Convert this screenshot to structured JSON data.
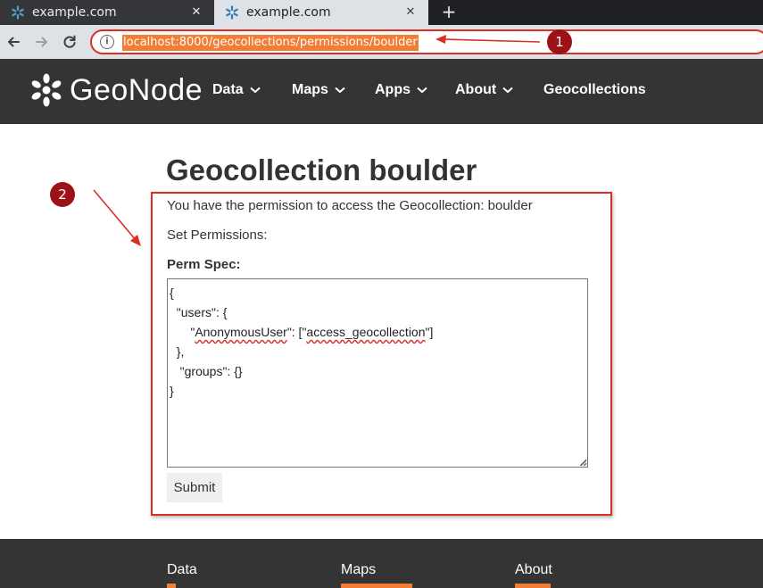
{
  "browser": {
    "tabs": [
      {
        "title": "example.com",
        "active": false
      },
      {
        "title": "example.com",
        "active": true
      }
    ],
    "new_tab_label": "+",
    "close_glyph": "✕",
    "url": "localhost:8000/geocollections/permissions/boulder",
    "nav_icons": [
      "arrow-back-icon",
      "arrow-forward-icon",
      "reload-icon"
    ]
  },
  "annotations": {
    "badge_1": "1",
    "badge_2": "2",
    "color": "#9c1216"
  },
  "header": {
    "logo_text": "GeoNode",
    "nav": [
      {
        "label": "Data",
        "has_dropdown": true
      },
      {
        "label": "Maps",
        "has_dropdown": true
      },
      {
        "label": "Apps",
        "has_dropdown": true
      },
      {
        "label": "About",
        "has_dropdown": true
      },
      {
        "label": "Geocollections",
        "has_dropdown": false
      }
    ],
    "background": "#343434"
  },
  "main": {
    "title": "Geocollection boulder",
    "access_message": "You have the permission to access the Geocollection: boulder",
    "set_permissions_label": "Set Permissions:",
    "perm_spec_label": "Perm Spec:",
    "perm_spec_lines": [
      "{",
      "  \"users\": {",
      "      \"",
      "AnonymousUser",
      "\": [\"",
      "access_geocollection",
      "\"]",
      "  },",
      "   \"groups\": {}",
      "}"
    ],
    "submit_label": "Submit"
  },
  "footer": {
    "columns": [
      "Data",
      "Maps",
      "About"
    ]
  },
  "colors": {
    "accent": "#f27d35",
    "annotation_red": "#d93025"
  }
}
